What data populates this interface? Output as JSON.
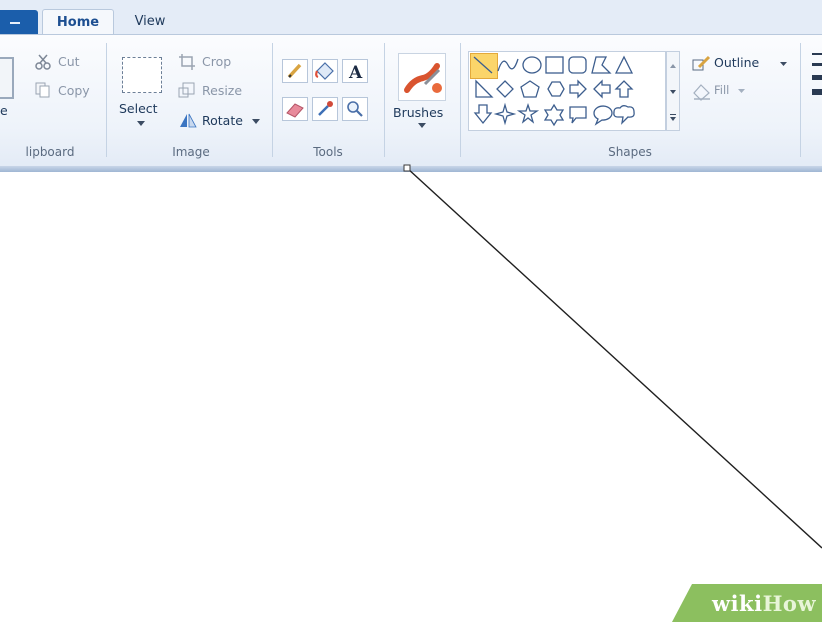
{
  "tabs": [
    {
      "label": "Home",
      "selected": true
    },
    {
      "label": "View",
      "selected": false
    }
  ],
  "groups": {
    "clipboard": {
      "label": "lipboard",
      "paste_label_fragment": "e",
      "cut_label": "Cut",
      "copy_label": "Copy"
    },
    "image": {
      "label": "Image",
      "select_label": "Select",
      "crop_label": "Crop",
      "resize_label": "Resize",
      "rotate_label": "Rotate"
    },
    "tools": {
      "label": "Tools",
      "icons": [
        "pencil-icon",
        "fill-bucket-icon",
        "text-icon",
        "eraser-icon",
        "color-picker-icon",
        "magnifier-icon"
      ],
      "text_tool_glyph": "A"
    },
    "brushes": {
      "label": "Brushes"
    },
    "shapes": {
      "label": "Shapes",
      "outline_label": "Outline",
      "fill_label": "Fill",
      "selected_shape": "line",
      "row1": [
        "line",
        "curve",
        "oval",
        "rectangle",
        "rounded-rectangle",
        "polygon",
        "triangle"
      ],
      "row2": [
        "right-triangle",
        "diamond",
        "pentagon",
        "hexagon",
        "right-arrow",
        "left-arrow",
        "up-arrow"
      ],
      "row3": [
        "down-arrow",
        "four-point-star",
        "five-point-star",
        "six-point-star",
        "rounded-callout",
        "oval-callout",
        "cloud-callout"
      ]
    }
  },
  "canvas": {
    "content": "diagonal line being drawn"
  },
  "watermark": {
    "wiki": "wiki",
    "how": "How"
  },
  "colors": {
    "ribbon_bg": "#eef3fa",
    "tab_bar_bg": "#e4ecf7",
    "file_tab": "#1b5eab",
    "selected_shape_highlight": "#fbd56a",
    "watermark_green": "#8cbf5f"
  }
}
